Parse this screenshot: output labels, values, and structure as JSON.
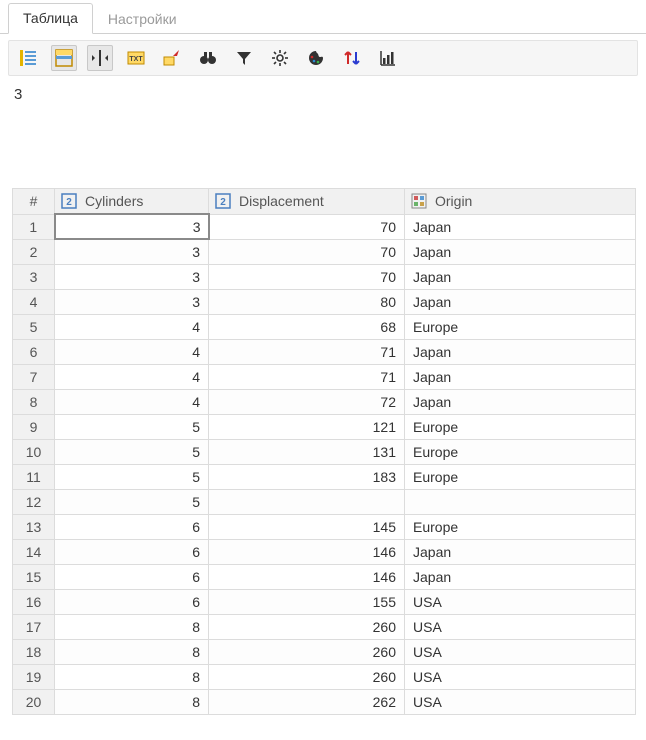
{
  "tabs": {
    "active": "Таблица",
    "inactive": "Настройки"
  },
  "toolbar": {
    "buttons": [
      {
        "name": "list-columns-icon"
      },
      {
        "name": "layout-icon"
      },
      {
        "name": "fit-width-icon"
      },
      {
        "name": "txt-icon"
      },
      {
        "name": "export-icon"
      },
      {
        "name": "binoculars-icon"
      },
      {
        "name": "filter-icon"
      },
      {
        "name": "settings-gear-icon"
      },
      {
        "name": "palette-icon"
      },
      {
        "name": "sort-icon"
      },
      {
        "name": "chart-icon"
      }
    ]
  },
  "cell_preview": "3",
  "columns": [
    {
      "id": "rownum",
      "label": "#",
      "type": "row"
    },
    {
      "id": "cyl",
      "label": "Cylinders",
      "type": "int"
    },
    {
      "id": "disp",
      "label": "Displacement",
      "type": "int"
    },
    {
      "id": "origin",
      "label": "Origin",
      "type": "cat"
    }
  ],
  "rows": [
    {
      "n": "1",
      "cyl": "3",
      "disp": "70",
      "origin": "Japan"
    },
    {
      "n": "2",
      "cyl": "3",
      "disp": "70",
      "origin": "Japan"
    },
    {
      "n": "3",
      "cyl": "3",
      "disp": "70",
      "origin": "Japan"
    },
    {
      "n": "4",
      "cyl": "3",
      "disp": "80",
      "origin": "Japan"
    },
    {
      "n": "5",
      "cyl": "4",
      "disp": "68",
      "origin": "Europe"
    },
    {
      "n": "6",
      "cyl": "4",
      "disp": "71",
      "origin": "Japan"
    },
    {
      "n": "7",
      "cyl": "4",
      "disp": "71",
      "origin": "Japan"
    },
    {
      "n": "8",
      "cyl": "4",
      "disp": "72",
      "origin": "Japan"
    },
    {
      "n": "9",
      "cyl": "5",
      "disp": "121",
      "origin": "Europe"
    },
    {
      "n": "10",
      "cyl": "5",
      "disp": "131",
      "origin": "Europe"
    },
    {
      "n": "11",
      "cyl": "5",
      "disp": "183",
      "origin": "Europe"
    },
    {
      "n": "12",
      "cyl": "5",
      "disp": "",
      "origin": ""
    },
    {
      "n": "13",
      "cyl": "6",
      "disp": "145",
      "origin": "Europe"
    },
    {
      "n": "14",
      "cyl": "6",
      "disp": "146",
      "origin": "Japan"
    },
    {
      "n": "15",
      "cyl": "6",
      "disp": "146",
      "origin": "Japan"
    },
    {
      "n": "16",
      "cyl": "6",
      "disp": "155",
      "origin": "USA"
    },
    {
      "n": "17",
      "cyl": "8",
      "disp": "260",
      "origin": "USA"
    },
    {
      "n": "18",
      "cyl": "8",
      "disp": "260",
      "origin": "USA"
    },
    {
      "n": "19",
      "cyl": "8",
      "disp": "260",
      "origin": "USA"
    },
    {
      "n": "20",
      "cyl": "8",
      "disp": "262",
      "origin": "USA"
    }
  ],
  "selected_cell": {
    "row": 0,
    "col": "cyl"
  }
}
